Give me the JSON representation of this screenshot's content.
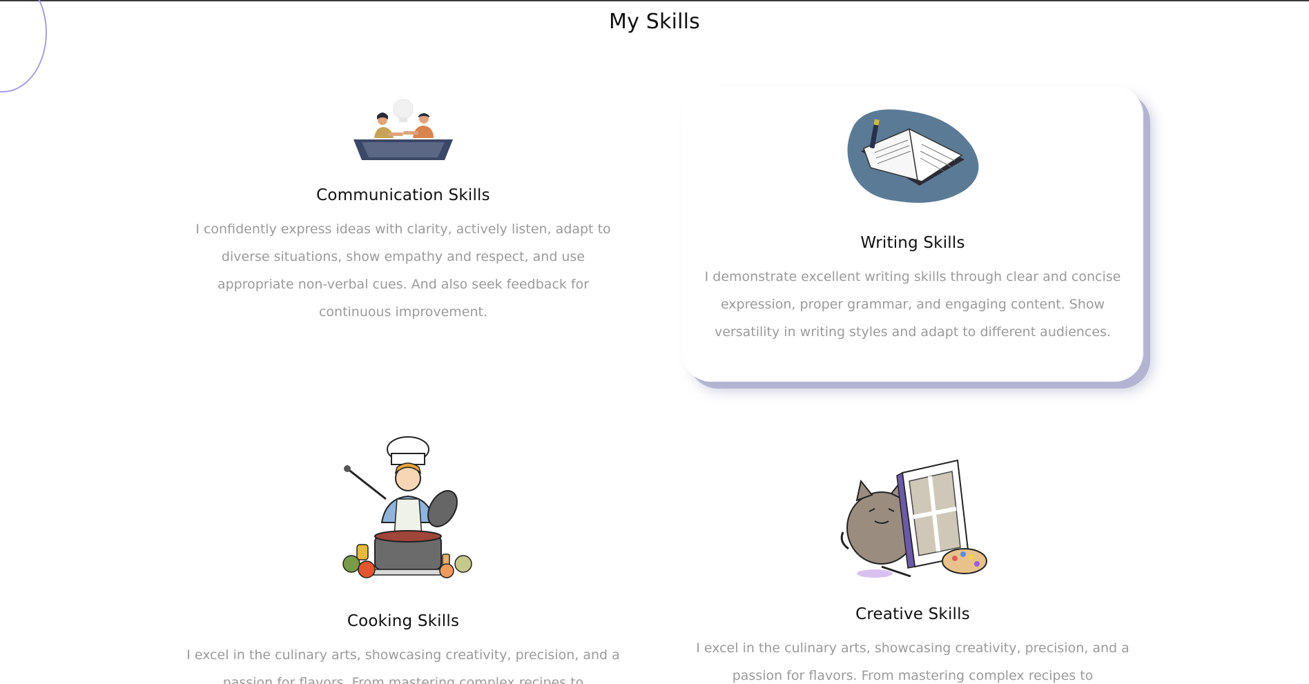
{
  "section": {
    "title": "My Skills"
  },
  "skills": [
    {
      "title": "Communication Skills",
      "description": "I confidently express ideas with clarity, actively listen, adapt to diverse situations, show empathy and respect, and use appropriate non-verbal cues. And also seek feedback for continuous improvement.",
      "illustration": "two-people-laptop-conversation-illustration"
    },
    {
      "title": "Writing Skills",
      "description": "I demonstrate excellent writing skills through clear and concise expression, proper grammar, and engaging content. Show versatility in writing styles and adapt to different audiences.",
      "illustration": "open-book-with-pen-illustration"
    },
    {
      "title": "Cooking Skills",
      "description": "I excel in the culinary arts, showcasing creativity, precision, and a passion for flavors. From mastering complex recipes to",
      "illustration": "chef-cooking-pot-illustration"
    },
    {
      "title": "Creative Skills",
      "description": "I excel in the culinary arts, showcasing creativity, precision, and a passion for flavors. From mastering complex recipes to",
      "illustration": "cat-painting-canvas-illustration"
    }
  ],
  "colors": {
    "accent_circle": "#a99ce0",
    "card_shadow": "#b4b4d2",
    "book_blob": "#5b7a95",
    "text_muted": "#9a9a9a"
  }
}
